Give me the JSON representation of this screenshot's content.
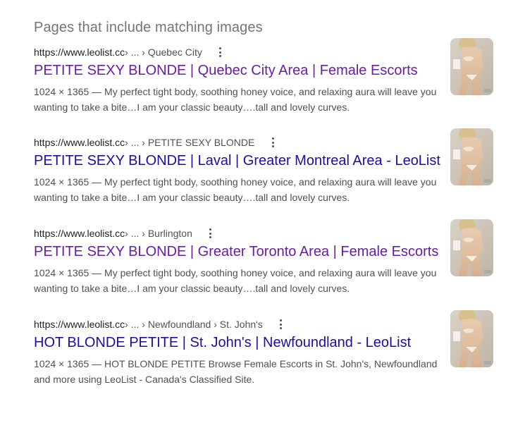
{
  "section_title": "Pages that include matching images",
  "results": [
    {
      "url_domain": "https://www.leolist.cc",
      "url_path": " › ... › Quebec City",
      "title": "PETITE SEXY BLONDE | Quebec City Area | Female Escorts",
      "dimensions": "1024 × 1365",
      "snippet": "My perfect tight body, soothing honey voice, and relaxing aura will leave you wanting to take a bite…I am your classic beauty….tall and lovely curves."
    },
    {
      "url_domain": "https://www.leolist.cc",
      "url_path": " › ... › PETITE SEXY BLONDE",
      "title": "PETITE SEXY BLONDE | Laval | Greater Montreal Area - LeoList",
      "dimensions": "1024 × 1365",
      "snippet": "My perfect tight body, soothing honey voice, and relaxing aura will leave you wanting to take a bite…I am your classic beauty….tall and lovely curves."
    },
    {
      "url_domain": "https://www.leolist.cc",
      "url_path": " › ... › Burlington",
      "title": "PETITE SEXY BLONDE | Greater Toronto Area | Female Escorts",
      "dimensions": "1024 × 1365",
      "snippet": "My perfect tight body, soothing honey voice, and relaxing aura will leave you wanting to take a bite…I am your classic beauty….tall and lovely curves."
    },
    {
      "url_domain": "https://www.leolist.cc",
      "url_path": " › ... › Newfoundland › St. John's",
      "title": "HOT BLONDE PETITE | St. John's | Newfoundland - LeoList",
      "dimensions": "1024 × 1365",
      "snippet": "HOT BLONDE PETITE Browse Female Escorts in St. John's, Newfoundland and more using LeoList - Canada's Classified Site."
    }
  ],
  "dimension_separator": " — ",
  "colors": {
    "visited_link": "#681da8",
    "unvisited_link": "#1a0dab",
    "snippet_text": "#4d5156",
    "section_title": "#70757a"
  },
  "icons": {
    "more_options": "three-dot-vertical-icon"
  }
}
